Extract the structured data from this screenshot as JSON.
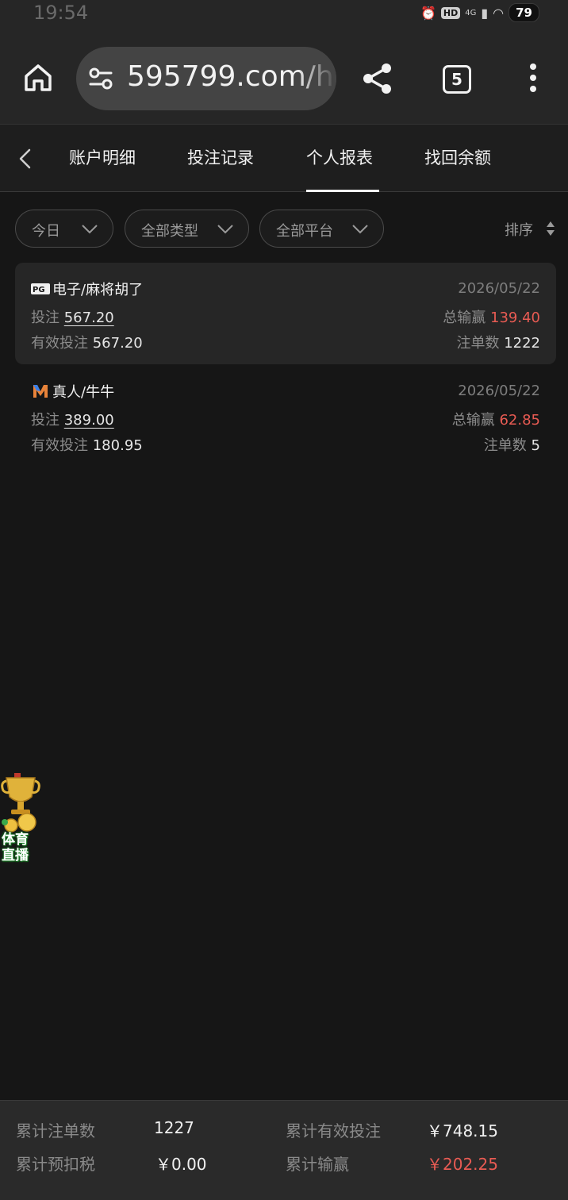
{
  "status_bar": {
    "time": "19:54",
    "network": "4G",
    "battery": "79",
    "icons": [
      "alarm-icon",
      "hd-icon",
      "signal-icon",
      "wifi-icon",
      "battery-icon"
    ]
  },
  "browser": {
    "url": "595799.com/h",
    "tab_count": "5"
  },
  "nav": {
    "tabs": [
      {
        "label": "账户明细",
        "active": false
      },
      {
        "label": "投注记录",
        "active": false
      },
      {
        "label": "个人报表",
        "active": true
      },
      {
        "label": "找回余额",
        "active": false
      }
    ]
  },
  "filters": {
    "items": [
      {
        "label": "今日"
      },
      {
        "label": "全部类型"
      },
      {
        "label": "全部平台"
      }
    ],
    "sort_label": "排序"
  },
  "records": [
    {
      "logo": "PG",
      "title": "电子/麻将胡了",
      "date": "2026/05/22",
      "bet_label": "投注",
      "bet": "567.20",
      "valid_bet_label": "有效投注",
      "valid_bet": "567.20",
      "win_loss_label": "总输赢",
      "win_loss": "139.40",
      "orders_label": "注单数",
      "orders": "1222"
    },
    {
      "logo": "M",
      "title": "真人/牛牛",
      "date": "2026/05/22",
      "bet_label": "投注",
      "bet": "389.00",
      "valid_bet_label": "有效投注",
      "valid_bet": "180.95",
      "win_loss_label": "总输赢",
      "win_loss": "62.85",
      "orders_label": "注单数",
      "orders": "5"
    }
  ],
  "floating_widget": {
    "line1": "体育",
    "line2": "直播"
  },
  "summary": {
    "total_orders_label": "累计注单数",
    "total_orders": "1227",
    "total_valid_bet_label": "累计有效投注",
    "total_valid_bet": "￥748.15",
    "tax_label": "累计预扣税",
    "tax": "￥0.00",
    "total_win_loss_label": "累计输赢",
    "total_win_loss": "￥202.25"
  },
  "colors": {
    "background": "#161616",
    "card": "#262626",
    "accent_red": "#e85b53",
    "footer": "#2a2a2a"
  }
}
